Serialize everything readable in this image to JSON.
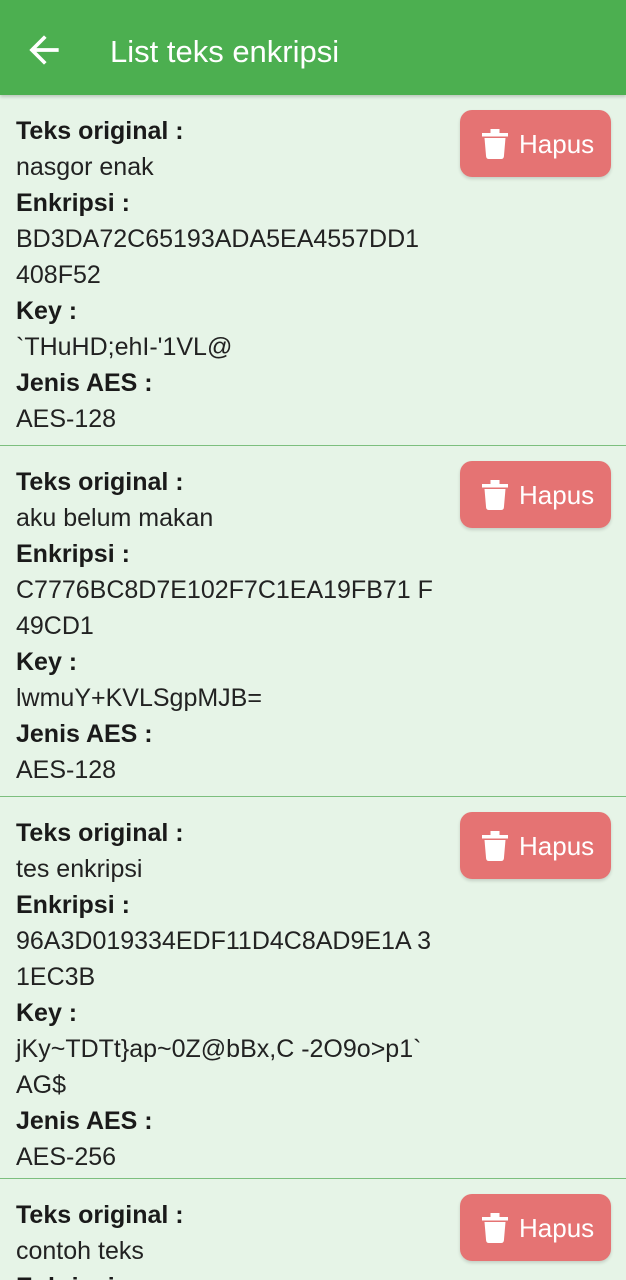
{
  "appbar": {
    "title": "List teks enkripsi",
    "back_icon": "arrow-left-icon",
    "background_color": "#4caf50"
  },
  "labels": {
    "original": "Teks original :",
    "encryption": "Enkripsi :",
    "key": "Key :",
    "aes_type": "Jenis AES :",
    "delete": "Hapus"
  },
  "colors": {
    "card_background": "#e6f4e7",
    "delete_button": "#e57373"
  },
  "items": [
    {
      "original": "nasgor enak",
      "encryption": "BD3DA72C65193ADA5EA4557DD1 408F52",
      "key": "`THuHD;ehI-'1VL@",
      "aes_type": "AES-128"
    },
    {
      "original": "aku belum makan",
      "encryption": "C7776BC8D7E102F7C1EA19FB71 F49CD1",
      "key": "lwmuY+KVLSgpMJB=",
      "aes_type": "AES-128"
    },
    {
      "original": "tes enkripsi",
      "encryption": "96A3D019334EDF11D4C8AD9E1A 31EC3B",
      "key": "jKy~TDTt}ap~0Z@bBx,C -2O9o>p1`AG$",
      "aes_type": "AES-256"
    },
    {
      "original": "contoh teks",
      "encryption": "",
      "key": "",
      "aes_type": ""
    }
  ]
}
